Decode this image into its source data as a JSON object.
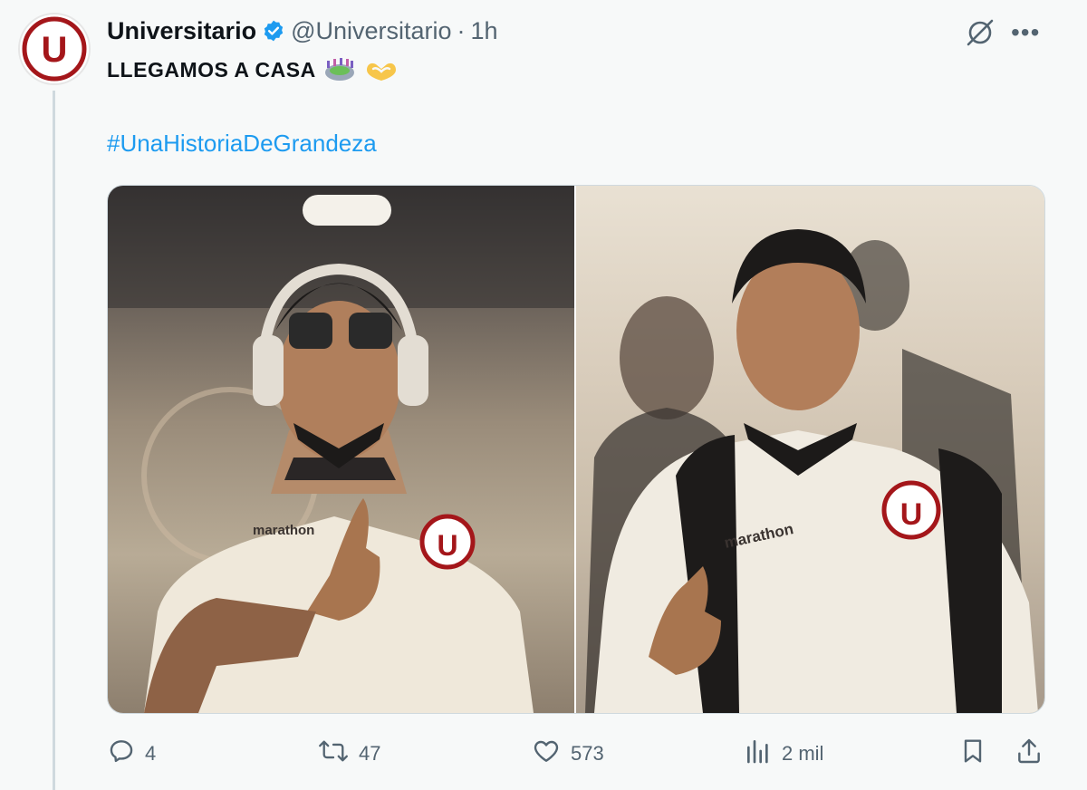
{
  "tweet": {
    "author_name": "Universitario",
    "handle": "@Universitario",
    "separator": "·",
    "time": "1h",
    "text": "LLEGAMOS A CASA",
    "emojis": [
      "stadium-emoji",
      "heart-hands-emoji"
    ],
    "hashtag": "#UnaHistoriaDeGrandeza",
    "avatar_letter": "U"
  },
  "media": {
    "photos": [
      {
        "jersey_text": "marathon",
        "badge_letter": "U"
      },
      {
        "jersey_text": "marathon",
        "badge_letter": "U"
      }
    ]
  },
  "actions": {
    "replies": "4",
    "reposts": "47",
    "likes": "573",
    "views": "2 mil"
  },
  "icons": [
    "verified-icon",
    "grok-icon",
    "more-icon",
    "reply-icon",
    "repost-icon",
    "like-icon",
    "views-icon",
    "bookmark-icon",
    "share-icon"
  ],
  "colors": {
    "accent": "#1d9bf0",
    "brand_red": "#a4161a",
    "muted": "#536471"
  }
}
